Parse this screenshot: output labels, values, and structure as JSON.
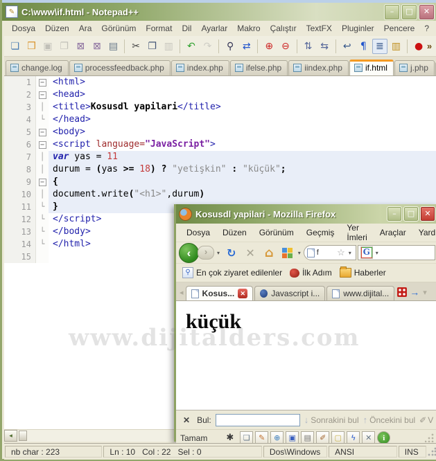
{
  "watermark": "www.dijitalders.com",
  "window_controls": {
    "minimize": "–",
    "maximize": "□",
    "close": "✕"
  },
  "npp": {
    "title": "C:\\www\\if.html - Notepad++",
    "menu": [
      "Dosya",
      "Düzen",
      "Ara",
      "Görünüm",
      "Format",
      "Dil",
      "Ayarlar",
      "Makro",
      "Çalıştır",
      "TextFX",
      "Pluginler",
      "Pencere",
      "?"
    ],
    "menu_close": "✕",
    "toolbar": [
      {
        "name": "new-file",
        "glyph": "❏",
        "color": "#4C7DB2"
      },
      {
        "name": "open-folder",
        "glyph": "❒",
        "color": "#D9952E"
      },
      {
        "name": "save",
        "glyph": "▣",
        "color": "#4C7DB2",
        "disabled": true
      },
      {
        "name": "save-all",
        "glyph": "❐",
        "color": "#4C7DB2",
        "disabled": true
      },
      {
        "name": "close-doc",
        "glyph": "⊠",
        "color": "#8A6E9E"
      },
      {
        "name": "close-all-docs",
        "glyph": "⊠",
        "color": "#8A6E9E"
      },
      {
        "name": "print",
        "glyph": "▤",
        "color": "#667788"
      },
      {
        "sep": true
      },
      {
        "name": "cut",
        "glyph": "✂",
        "color": "#444444"
      },
      {
        "name": "copy",
        "glyph": "❐",
        "color": "#445577"
      },
      {
        "name": "paste",
        "glyph": "▥",
        "color": "#888888",
        "disabled": true
      },
      {
        "sep": true
      },
      {
        "name": "undo",
        "glyph": "↶",
        "color": "#2FA12F"
      },
      {
        "name": "redo",
        "glyph": "↷",
        "color": "#999999",
        "disabled": true
      },
      {
        "sep": true
      },
      {
        "name": "find",
        "glyph": "⚲",
        "color": "#333355"
      },
      {
        "name": "replace",
        "glyph": "⇄",
        "color": "#2255CC"
      },
      {
        "sep": true
      },
      {
        "name": "zoom-in",
        "glyph": "⊕",
        "color": "#CC2222"
      },
      {
        "name": "zoom-out",
        "glyph": "⊖",
        "color": "#CC2222"
      },
      {
        "sep": true
      },
      {
        "name": "sync-vertical",
        "glyph": "⇅",
        "color": "#556699"
      },
      {
        "name": "sync-horizontal",
        "glyph": "⇆",
        "color": "#556699"
      },
      {
        "sep": true
      },
      {
        "name": "word-wrap",
        "glyph": "↩",
        "color": "#335588"
      },
      {
        "name": "show-all-characters",
        "glyph": "¶",
        "color": "#2255CC"
      },
      {
        "name": "indent-guide",
        "glyph": "≣",
        "color": "#335588",
        "pressed": true
      },
      {
        "name": "doc-map",
        "glyph": "▥",
        "color": "#C09020"
      },
      {
        "sep": true
      },
      {
        "name": "record-macro",
        "glyph": "●",
        "color": "#CC1111"
      }
    ],
    "toolbar_overflow": "»",
    "tabs": [
      {
        "label": "change.log"
      },
      {
        "label": "processfeedback.php"
      },
      {
        "label": "index.php"
      },
      {
        "label": "ifelse.php"
      },
      {
        "label": "iindex.php"
      },
      {
        "label": "if.html",
        "active": true
      },
      {
        "label": "j.php"
      },
      {
        "label": "",
        "partial": true
      }
    ],
    "tab_scroll": {
      "left": "◂",
      "right": "▸"
    },
    "hscroll_arrow": "◂",
    "code": {
      "lines": [
        {
          "num": "1",
          "fold": "m",
          "segs": [
            [
              "tag",
              "<html>"
            ]
          ]
        },
        {
          "num": "2",
          "fold": "m",
          "segs": [
            [
              "tag",
              "<head>"
            ]
          ]
        },
        {
          "num": "3",
          "fold": "l",
          "segs": [
            [
              "tag",
              "<title>"
            ],
            [
              "b",
              "Kosusdl yapilari"
            ],
            [
              "tag",
              "</title>"
            ]
          ]
        },
        {
          "num": "4",
          "fold": "e",
          "segs": [
            [
              "tag",
              "</head>"
            ]
          ]
        },
        {
          "num": "5",
          "fold": "m",
          "segs": [
            [
              "tag",
              "<body>"
            ]
          ]
        },
        {
          "num": "6",
          "fold": "m",
          "segs": [
            [
              "tag",
              "<script "
            ],
            [
              "attr",
              "language="
            ],
            [
              "val",
              "\"JavaScript\""
            ],
            [
              "tag",
              ">"
            ]
          ]
        },
        {
          "num": "7",
          "fold": "l",
          "js": true,
          "segs": [
            [
              "kw",
              "var"
            ],
            [
              "pl",
              " yas = "
            ],
            [
              "num",
              "11"
            ]
          ]
        },
        {
          "num": "8",
          "fold": "l",
          "js": true,
          "segs": [
            [
              "pl",
              "durum = "
            ],
            [
              "pu",
              "("
            ],
            [
              "pl",
              "yas "
            ],
            [
              "pu",
              ">="
            ],
            [
              "pl",
              " "
            ],
            [
              "num",
              "18"
            ],
            [
              "pu",
              ")"
            ],
            [
              "pl",
              " "
            ],
            [
              "pu",
              "?"
            ],
            [
              "pl",
              " "
            ],
            [
              "str",
              "\"yetişkin\""
            ],
            [
              "pl",
              " "
            ],
            [
              "pu",
              ":"
            ],
            [
              "pl",
              " "
            ],
            [
              "str",
              "\"küçük\""
            ],
            [
              "pu",
              ";"
            ]
          ]
        },
        {
          "num": "9",
          "fold": "m",
          "js": true,
          "segs": [
            [
              "pu",
              "{"
            ]
          ]
        },
        {
          "num": "10",
          "fold": "l",
          "js": true,
          "segs": [
            [
              "pl",
              "document.write"
            ],
            [
              "pu",
              "("
            ],
            [
              "str",
              "\"<h1>\""
            ],
            [
              "pl",
              ",durum"
            ],
            [
              "pu",
              ")"
            ]
          ]
        },
        {
          "num": "11",
          "fold": "e",
          "js": true,
          "segs": [
            [
              "pu",
              "}"
            ]
          ]
        },
        {
          "num": "12",
          "fold": "e",
          "segs": [
            [
              "tag",
              "</script>"
            ]
          ]
        },
        {
          "num": "13",
          "fold": "e",
          "segs": [
            [
              "tag",
              "</body>"
            ]
          ]
        },
        {
          "num": "14",
          "fold": "e",
          "segs": [
            [
              "tag",
              "</html>"
            ]
          ]
        },
        {
          "num": "15",
          "segs": []
        }
      ]
    },
    "status": {
      "chars": "nb char : 223",
      "line": "Ln : 10",
      "col": "Col : 22",
      "sel": "Sel : 0",
      "eol": "Dos\\Windows",
      "encoding": "ANSI",
      "mode": "INS"
    }
  },
  "firefox": {
    "title": "Kosusdl yapilari - Mozilla Firefox",
    "menu": [
      "Dosya",
      "Düzen",
      "Görünüm",
      "Geçmiş",
      "Yer İmleri",
      "Araçlar",
      "Yardım"
    ],
    "nav": {
      "back": "‹",
      "forward": "›",
      "dropdown": "▾",
      "refresh": "↻",
      "stop": "✕",
      "home": "⌂",
      "url_text": "f",
      "star": "☆",
      "search_logo": "G",
      "search_dropdown": "▾"
    },
    "bookmarks": [
      {
        "label": "En çok ziyaret edilenler",
        "icon": "magnifier-icon"
      },
      {
        "label": "İlk Adım",
        "icon": "firefox-start-icon"
      },
      {
        "label": "Haberler",
        "icon": "feed-folder-icon"
      }
    ],
    "tabbar": {
      "left_arrow": "◂",
      "right_arrow": "→",
      "dropdown": "▾",
      "close_glyph": "✕"
    },
    "tabs": [
      {
        "label": "Kosus...",
        "active": true,
        "icon": "page",
        "close": true
      },
      {
        "label": "Javascript i...",
        "icon": "js"
      },
      {
        "label": "www.dijital...",
        "icon": "page"
      }
    ],
    "content": {
      "heading": "küçük"
    },
    "findbar": {
      "close": "✕",
      "label": "Bul:",
      "next_icon": "↓",
      "next_label": "Sonrakini bul",
      "prev_icon": "↑",
      "prev_label": "Öncekini bul",
      "highlight_icon": "✐",
      "highlight_partial": "V"
    },
    "statusbar": {
      "text": "Tamam",
      "icons": [
        {
          "name": "bug-icon",
          "glyph": "✱",
          "color": "#3A3A3A",
          "boxed": false
        },
        {
          "name": "new-page-icon",
          "glyph": "❏",
          "color": "#667788",
          "boxed": true
        },
        {
          "name": "edit-pencil-icon",
          "glyph": "✎",
          "color": "#C07030",
          "boxed": true
        },
        {
          "name": "globe-icon",
          "glyph": "⊕",
          "color": "#3A7DBF",
          "boxed": true
        },
        {
          "name": "save-icon",
          "glyph": "▣",
          "color": "#3A5FBF",
          "boxed": true
        },
        {
          "name": "print-icon",
          "glyph": "▤",
          "color": "#777777",
          "boxed": true
        },
        {
          "name": "eraser-icon",
          "glyph": "✐",
          "color": "#A0622D",
          "boxed": true
        },
        {
          "name": "note-icon",
          "glyph": "▢",
          "color": "#C9B24A",
          "boxed": true
        },
        {
          "name": "lightning-icon",
          "glyph": "ϟ",
          "color": "#2255CC",
          "boxed": true
        },
        {
          "name": "tools-icon",
          "glyph": "✕",
          "color": "#667788",
          "boxed": true
        },
        {
          "name": "info-icon",
          "glyph": "i",
          "color": "#FFFFFF",
          "boxed": true,
          "green": true
        }
      ]
    }
  },
  "colors": {
    "titlebar_olive": "#7F9A52",
    "active_tab_accent": "#F59A23",
    "js_zone_bg": "#E9EEF8",
    "close_button_red": "#C23A30"
  }
}
